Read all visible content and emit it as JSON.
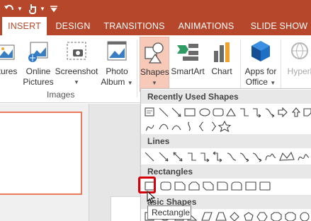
{
  "colors": {
    "accent": "#b7472a",
    "selected_bg": "#f6c9b9",
    "highlight": "#d6000c"
  },
  "quick_access": {
    "icons": [
      "undo-icon",
      "touch-mode-icon",
      "dropdown-icon",
      "customize-icon"
    ]
  },
  "tabs": [
    {
      "label": "INSERT",
      "active": true
    },
    {
      "label": "DESIGN"
    },
    {
      "label": "TRANSITIONS"
    },
    {
      "label": "ANIMATIONS"
    },
    {
      "label": "SLIDE SHOW"
    }
  ],
  "ribbon": {
    "pictures_label": "tures",
    "online_pictures_label_1": "Online",
    "online_pictures_label_2": "Pictures",
    "screenshot_label": "Screenshot",
    "photo_album_label_1": "Photo",
    "photo_album_label_2": "Album",
    "images_group_label": "Images",
    "shapes_label": "Shapes",
    "smartart_label": "SmartArt",
    "chart_label": "Chart",
    "apps_label_1": "Apps for",
    "apps_label_2": "Office",
    "hyperlink_label": "Hyperl"
  },
  "gallery": {
    "sections": {
      "recent": "Recently Used Shapes",
      "lines": "Lines",
      "rectangles": "Rectangles",
      "basic": "asic Shapes"
    }
  },
  "tooltip": "Rectangle"
}
